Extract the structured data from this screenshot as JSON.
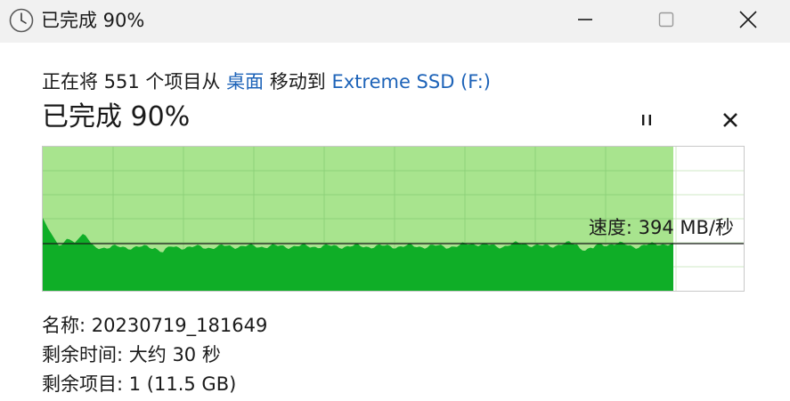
{
  "window": {
    "title": "已完成 90%",
    "minimize_glyph": "—",
    "maximize_glyph": "☐",
    "close_glyph": "✕"
  },
  "transfer": {
    "prefix": "正在将 551 个项目从 ",
    "source": "桌面",
    "middle": " 移动到 ",
    "destination": "Extreme SSD (F:)",
    "status": "已完成 90%",
    "percent_complete": 90,
    "pause_glyph": "⏸",
    "cancel_glyph": "✕"
  },
  "speed": {
    "text": "速度: 394 MB/秒"
  },
  "details": {
    "name_label": "名称: ",
    "name_value": "20230719_181649",
    "time_label": "剩余时间: ",
    "time_value": "大约 30 秒",
    "items_label": "剩余项目: ",
    "items_value": "1 (11.5 GB)"
  },
  "colors": {
    "progress_fill": "#a8e48e",
    "speed_fill": "#0fae27",
    "speed_line": "#1a1a1a",
    "grid": "#8ed27a",
    "link": "#1d63b8",
    "titlebar": "#f1f1f1"
  },
  "icons": {
    "title": "clock-icon",
    "pause": "pause-icon",
    "cancel": "close-icon"
  }
}
